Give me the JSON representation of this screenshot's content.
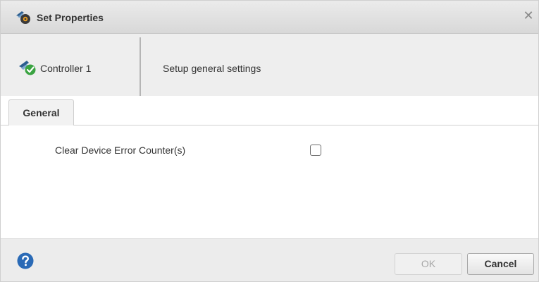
{
  "dialog": {
    "title": "Set Properties",
    "close_symbol": "✕"
  },
  "header": {
    "device_name": "Controller 1",
    "description": "Setup general settings"
  },
  "tabs": [
    {
      "label": "General",
      "selected": true
    }
  ],
  "general": {
    "clear_error_counters_label": "Clear Device Error Counter(s)",
    "clear_error_counters_checked": false
  },
  "footer": {
    "ok_label": "OK",
    "ok_enabled": false,
    "cancel_label": "Cancel"
  },
  "icons": {
    "title": "settings-gear-icon",
    "device": "controller-ok-icon",
    "help": "help-icon",
    "close": "close-icon"
  },
  "colors": {
    "help_blue": "#2a6ab6",
    "status_green": "#3aa341",
    "device_blue": "#2c5e8f"
  }
}
